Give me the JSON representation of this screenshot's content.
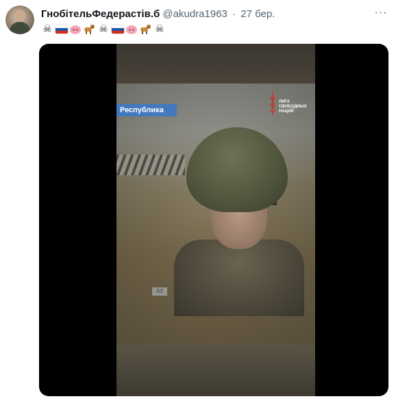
{
  "tweet": {
    "display_name": "ГнобітельФедерастів.б",
    "handle": "@akudra1963",
    "separator": "·",
    "date": "27 бер.",
    "more_label": "···",
    "emoji_sequence": [
      "skull-crossbones",
      "russia-flag",
      "pig-face",
      "dog",
      "skull-crossbones",
      "russia-flag",
      "pig-face",
      "dog",
      "skull-crossbones"
    ]
  },
  "media": {
    "type": "video",
    "channel_label": "Республика",
    "watermark_text": "ЛИГА\nСВОБОДНЫХ\nНАЦИЙ",
    "corner_tag": "A3"
  },
  "colors": {
    "name_text": "#0f1419",
    "meta_text": "#536471",
    "media_bg": "#000000",
    "channel_bar": "#3d78c7",
    "watermark_accent": "#d52b1e"
  }
}
